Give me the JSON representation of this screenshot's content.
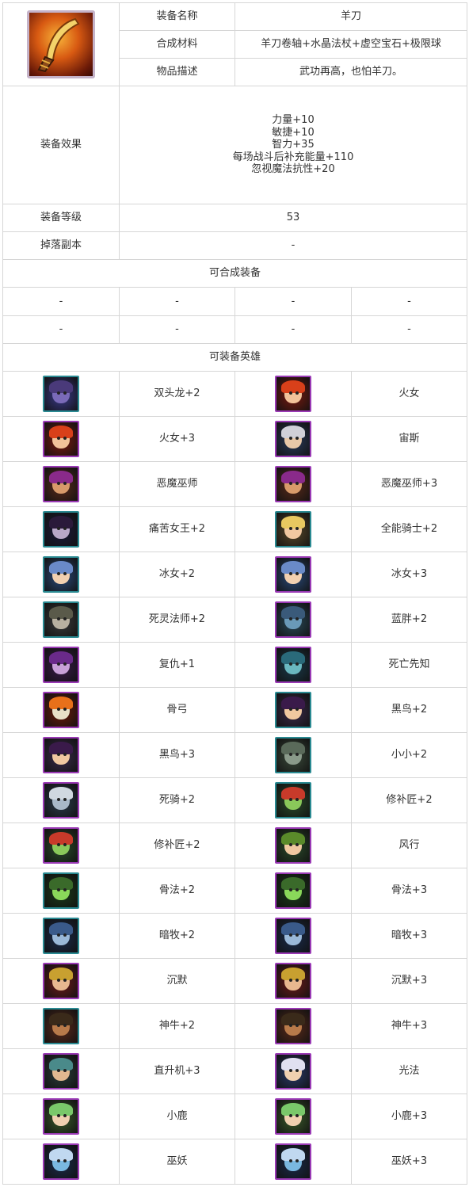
{
  "item": {
    "icon": "scythe-blade-icon",
    "name_label": "装备名称",
    "name": "羊刀",
    "materials_label": "合成材料",
    "materials": "羊刀卷轴+水晶法杖+虚空宝石+极限球",
    "desc_label": "物品描述",
    "desc": "武功再高，也怕羊刀。",
    "effects_label": "装备效果",
    "effects": [
      "力量+10",
      "敏捷+10",
      "智力+35",
      "每场战斗后补充能量+110",
      "忽视魔法抗性+20"
    ],
    "level_label": "装备等级",
    "level": "53",
    "drop_label": "掉落副本",
    "drop": "-"
  },
  "craftable": {
    "title": "可合成装备",
    "rows": [
      [
        "-",
        "-",
        "-",
        "-"
      ],
      [
        "-",
        "-",
        "-",
        "-"
      ]
    ]
  },
  "heroes": {
    "title": "可装备英雄",
    "rows": [
      [
        {
          "name": "双头龙+2",
          "icon": "two-headed-dragon-portrait-icon",
          "frame": "#2a8a92",
          "bg": "#3a3a8a",
          "skin": "#7a6ab8",
          "hair": "#4a3a7a"
        },
        {
          "name": "火女",
          "icon": "fire-girl-portrait-icon",
          "frame": "#9a3ab5",
          "bg": "#7a1a10",
          "skin": "#f2c39a",
          "hair": "#d8401a"
        }
      ],
      [
        {
          "name": "火女+3",
          "icon": "fire-girl-portrait-icon",
          "frame": "#9a3ab5",
          "bg": "#7a1a10",
          "skin": "#f2c39a",
          "hair": "#d8401a"
        },
        {
          "name": "宙斯",
          "icon": "zeus-portrait-icon",
          "frame": "#9a3ab5",
          "bg": "#2a3a5a",
          "skin": "#e8c8a8",
          "hair": "#d0d0d8"
        }
      ],
      [
        {
          "name": "恶魔巫师",
          "icon": "demon-wizard-portrait-icon",
          "frame": "#9a3ab5",
          "bg": "#5a2a1a",
          "skin": "#d89a6a",
          "hair": "#8a2a8a"
        },
        {
          "name": "恶魔巫师+3",
          "icon": "demon-wizard-portrait-icon",
          "frame": "#9a3ab5",
          "bg": "#5a2a1a",
          "skin": "#d89a6a",
          "hair": "#8a2a8a"
        }
      ],
      [
        {
          "name": "痛苦女王+2",
          "icon": "queen-of-pain-portrait-icon",
          "frame": "#2a8a92",
          "bg": "#1a1a3a",
          "skin": "#b8a8c8",
          "hair": "#2a1a3a"
        },
        {
          "name": "全能骑士+2",
          "icon": "omniknight-portrait-icon",
          "frame": "#2a8a92",
          "bg": "#5a4a2a",
          "skin": "#f0c8a0",
          "hair": "#e8c860"
        }
      ],
      [
        {
          "name": "冰女+2",
          "icon": "crystal-maiden-portrait-icon",
          "frame": "#2a8a92",
          "bg": "#2a4a7a",
          "skin": "#f2d0b0",
          "hair": "#6a8ac8"
        },
        {
          "name": "冰女+3",
          "icon": "crystal-maiden-portrait-icon",
          "frame": "#9a3ab5",
          "bg": "#2a4a7a",
          "skin": "#f2d0b0",
          "hair": "#6a8ac8"
        }
      ],
      [
        {
          "name": "死灵法师+2",
          "icon": "necrolyte-portrait-icon",
          "frame": "#2a8a92",
          "bg": "#3a3a3a",
          "skin": "#b8b0a0",
          "hair": "#5a5a4a"
        },
        {
          "name": "蓝胖+2",
          "icon": "ogre-magi-portrait-icon",
          "frame": "#9a3ab5",
          "bg": "#2a4a5a",
          "skin": "#6a9ab8",
          "hair": "#3a5a7a"
        }
      ],
      [
        {
          "name": "复仇+1",
          "icon": "vengeful-spirit-portrait-icon",
          "frame": "#9a3ab5",
          "bg": "#3a1a4a",
          "skin": "#c8a0d8",
          "hair": "#6a2a8a"
        },
        {
          "name": "死亡先知",
          "icon": "death-prophet-portrait-icon",
          "frame": "#9a3ab5",
          "bg": "#1a3a4a",
          "skin": "#6ab8c0",
          "hair": "#2a6a7a"
        }
      ],
      [
        {
          "name": "骨弓",
          "icon": "bone-archer-portrait-icon",
          "frame": "#9a3ab5",
          "bg": "#6a1a0a",
          "skin": "#e8e0c8",
          "hair": "#e8701a"
        },
        {
          "name": "黑鸟+2",
          "icon": "obsidian-destroyer-portrait-icon",
          "frame": "#2a8a92",
          "bg": "#3a2a4a",
          "skin": "#f0c8a0",
          "hair": "#3a1a4a"
        }
      ],
      [
        {
          "name": "黑鸟+3",
          "icon": "obsidian-destroyer-portrait-icon",
          "frame": "#9a3ab5",
          "bg": "#3a2a4a",
          "skin": "#f0c8a0",
          "hair": "#3a1a4a"
        },
        {
          "name": "小小+2",
          "icon": "tiny-portrait-icon",
          "frame": "#2a8a92",
          "bg": "#3a4a3a",
          "skin": "#8a9a8a",
          "hair": "#5a6a5a"
        }
      ],
      [
        {
          "name": "死骑+2",
          "icon": "death-knight-portrait-icon",
          "frame": "#9a3ab5",
          "bg": "#2a3a4a",
          "skin": "#a8b8c8",
          "hair": "#d0d8e0"
        },
        {
          "name": "修补匠+2",
          "icon": "tinker-portrait-icon",
          "frame": "#2a8a92",
          "bg": "#2a4a2a",
          "skin": "#8ac85a",
          "hair": "#c83a2a"
        }
      ],
      [
        {
          "name": "修补匠+2",
          "icon": "tinker-portrait-icon",
          "frame": "#9a3ab5",
          "bg": "#2a4a2a",
          "skin": "#8ac85a",
          "hair": "#c83a2a"
        },
        {
          "name": "风行",
          "icon": "windrunner-portrait-icon",
          "frame": "#9a3ab5",
          "bg": "#2a4a2a",
          "skin": "#f0c8a0",
          "hair": "#5a8a2a"
        }
      ],
      [
        {
          "name": "骨法+2",
          "icon": "pugna-portrait-icon",
          "frame": "#2a8a92",
          "bg": "#1a3a1a",
          "skin": "#8ad85a",
          "hair": "#3a6a2a"
        },
        {
          "name": "骨法+3",
          "icon": "pugna-portrait-icon",
          "frame": "#9a3ab5",
          "bg": "#1a3a1a",
          "skin": "#8ad85a",
          "hair": "#3a6a2a"
        }
      ],
      [
        {
          "name": "暗牧+2",
          "icon": "shadow-priest-portrait-icon",
          "frame": "#2a8a92",
          "bg": "#1a2a4a",
          "skin": "#9ab8d8",
          "hair": "#3a5a8a"
        },
        {
          "name": "暗牧+3",
          "icon": "shadow-priest-portrait-icon",
          "frame": "#9a3ab5",
          "bg": "#1a2a4a",
          "skin": "#9ab8d8",
          "hair": "#3a5a8a"
        }
      ],
      [
        {
          "name": "沉默",
          "icon": "silencer-portrait-icon",
          "frame": "#9a3ab5",
          "bg": "#6a1a1a",
          "skin": "#e8b890",
          "hair": "#c8a030"
        },
        {
          "name": "沉默+3",
          "icon": "silencer-portrait-icon",
          "frame": "#9a3ab5",
          "bg": "#6a1a1a",
          "skin": "#e8b890",
          "hair": "#c8a030"
        }
      ],
      [
        {
          "name": "神牛+2",
          "icon": "earthshaker-portrait-icon",
          "frame": "#2a8a92",
          "bg": "#5a2a1a",
          "skin": "#b87a4a",
          "hair": "#3a2a1a"
        },
        {
          "name": "神牛+3",
          "icon": "earthshaker-portrait-icon",
          "frame": "#9a3ab5",
          "bg": "#5a2a1a",
          "skin": "#b87a4a",
          "hair": "#3a2a1a"
        }
      ],
      [
        {
          "name": "直升机+3",
          "icon": "gyrocopter-portrait-icon",
          "frame": "#9a3ab5",
          "bg": "#2a3a3a",
          "skin": "#e0b890",
          "hair": "#4a8a8a"
        },
        {
          "name": "光法",
          "icon": "keeper-of-light-portrait-icon",
          "frame": "#9a3ab5",
          "bg": "#2a3a6a",
          "skin": "#f0d0b0",
          "hair": "#e0e0f0"
        }
      ],
      [
        {
          "name": "小鹿",
          "icon": "enchantress-portrait-icon",
          "frame": "#9a3ab5",
          "bg": "#3a5a2a",
          "skin": "#f0d0b0",
          "hair": "#7ac86a"
        },
        {
          "name": "小鹿+3",
          "icon": "enchantress-portrait-icon",
          "frame": "#9a3ab5",
          "bg": "#3a5a2a",
          "skin": "#f0d0b0",
          "hair": "#7ac86a"
        }
      ],
      [
        {
          "name": "巫妖",
          "icon": "lich-portrait-icon",
          "frame": "#9a3ab5",
          "bg": "#1a2a4a",
          "skin": "#7ab8e0",
          "hair": "#c0d8f0"
        },
        {
          "name": "巫妖+3",
          "icon": "lich-portrait-icon",
          "frame": "#9a3ab5",
          "bg": "#1a2a4a",
          "skin": "#7ab8e0",
          "hair": "#c0d8f0"
        }
      ]
    ]
  }
}
